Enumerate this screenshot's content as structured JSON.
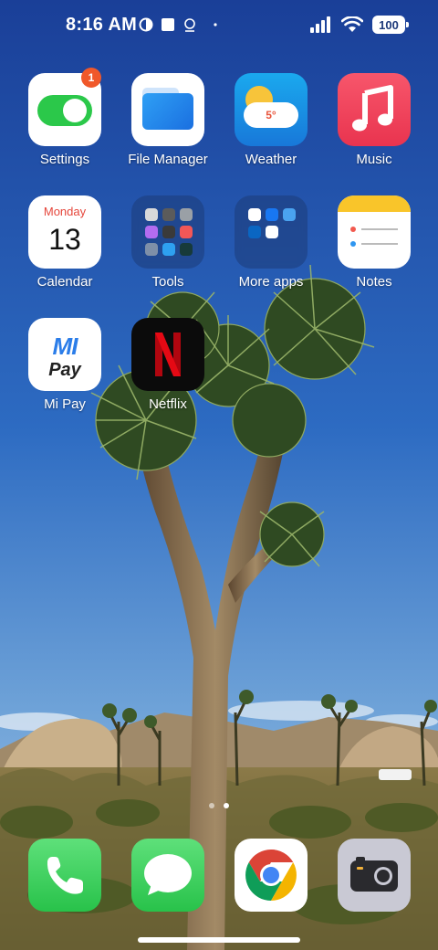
{
  "status_bar": {
    "time": "8:16 AM",
    "left_icons": [
      "vpn-icon",
      "square-icon",
      "alarm-icon",
      "dot-icon"
    ],
    "right_icons": [
      "signal-icon",
      "wifi-icon"
    ],
    "battery": "100"
  },
  "apps": {
    "settings": {
      "label": "Settings",
      "badge": "1"
    },
    "file_manager": {
      "label": "File Manager"
    },
    "weather": {
      "label": "Weather",
      "temp": "5°"
    },
    "music": {
      "label": "Music"
    },
    "calendar": {
      "label": "Calendar",
      "day_name": "Monday",
      "day_number": "13"
    },
    "tools": {
      "label": "Tools"
    },
    "more_apps": {
      "label": "More apps"
    },
    "notes": {
      "label": "Notes"
    },
    "mi_pay": {
      "label": "Mi Pay",
      "logo_top": "MI",
      "logo_bottom": "Pay"
    },
    "netflix": {
      "label": "Netflix"
    }
  },
  "dock": [
    "phone",
    "messages",
    "chrome",
    "camera"
  ],
  "page_indicator": {
    "pages": 2,
    "current": 2
  },
  "colors": {
    "sky_top": "#1c4aa3",
    "sky_bottom": "#6b9bd4",
    "badge": "#f0582a",
    "settings_toggle": "#2bc84a",
    "music": "#f24561",
    "netflix_red": "#e50914",
    "phone_green": "#34c759"
  }
}
